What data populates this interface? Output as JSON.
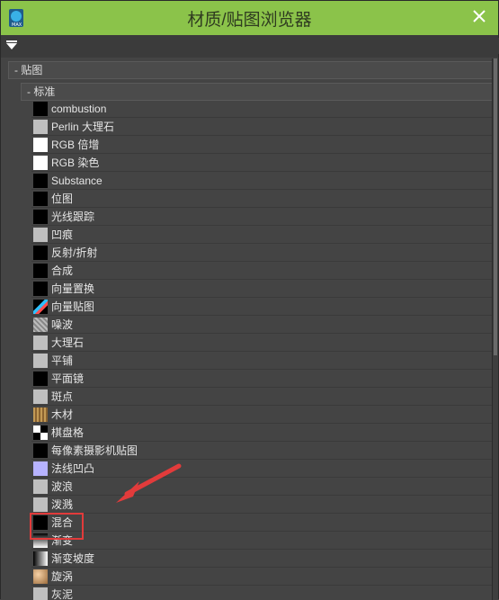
{
  "window": {
    "title": "材质/贴图浏览器"
  },
  "toolbar": {
    "filter_placeholder": "",
    "filter_value": ""
  },
  "tree": {
    "category": "- 贴图",
    "subcategory": "- 标准",
    "items": [
      {
        "label": "combustion",
        "swatch": "black"
      },
      {
        "label": "Perlin 大理石",
        "swatch": "marble-pattern"
      },
      {
        "label": "RGB 倍增",
        "swatch": "white"
      },
      {
        "label": "RGB 染色",
        "swatch": "white"
      },
      {
        "label": "Substance",
        "swatch": "black"
      },
      {
        "label": "位图",
        "swatch": "black"
      },
      {
        "label": "光线跟踪",
        "swatch": "black"
      },
      {
        "label": "凹痕",
        "swatch": "dent-pattern"
      },
      {
        "label": "反射/折射",
        "swatch": "black"
      },
      {
        "label": "合成",
        "swatch": "black"
      },
      {
        "label": "向量置换",
        "swatch": "black"
      },
      {
        "label": "向量贴图",
        "swatch": "vector-pattern"
      },
      {
        "label": "噪波",
        "swatch": "noise-pattern"
      },
      {
        "label": "大理石",
        "swatch": "marble-pattern"
      },
      {
        "label": "平铺",
        "swatch": "tile-pattern"
      },
      {
        "label": "平面镜",
        "swatch": "black"
      },
      {
        "label": "斑点",
        "swatch": "speckle-pattern"
      },
      {
        "label": "木材",
        "swatch": "wood-pattern"
      },
      {
        "label": "棋盘格",
        "swatch": "checker-pattern"
      },
      {
        "label": "每像素摄影机贴图",
        "swatch": "black"
      },
      {
        "label": "法线凹凸",
        "swatch": "purple"
      },
      {
        "label": "波浪",
        "swatch": "wave-pattern"
      },
      {
        "label": "泼溅",
        "swatch": "splat-pattern"
      },
      {
        "label": "混合",
        "swatch": "black"
      },
      {
        "label": "渐变",
        "swatch": "gradient"
      },
      {
        "label": "渐变坡度",
        "swatch": "gradient-ramp"
      },
      {
        "label": "旋涡",
        "swatch": "swirl"
      },
      {
        "label": "灰泥",
        "swatch": "stucco-pattern"
      }
    ]
  },
  "colors": {
    "titlebar": "#8bc34a",
    "highlight_box": "#e23b3b",
    "arrow": "#e23b3b"
  }
}
